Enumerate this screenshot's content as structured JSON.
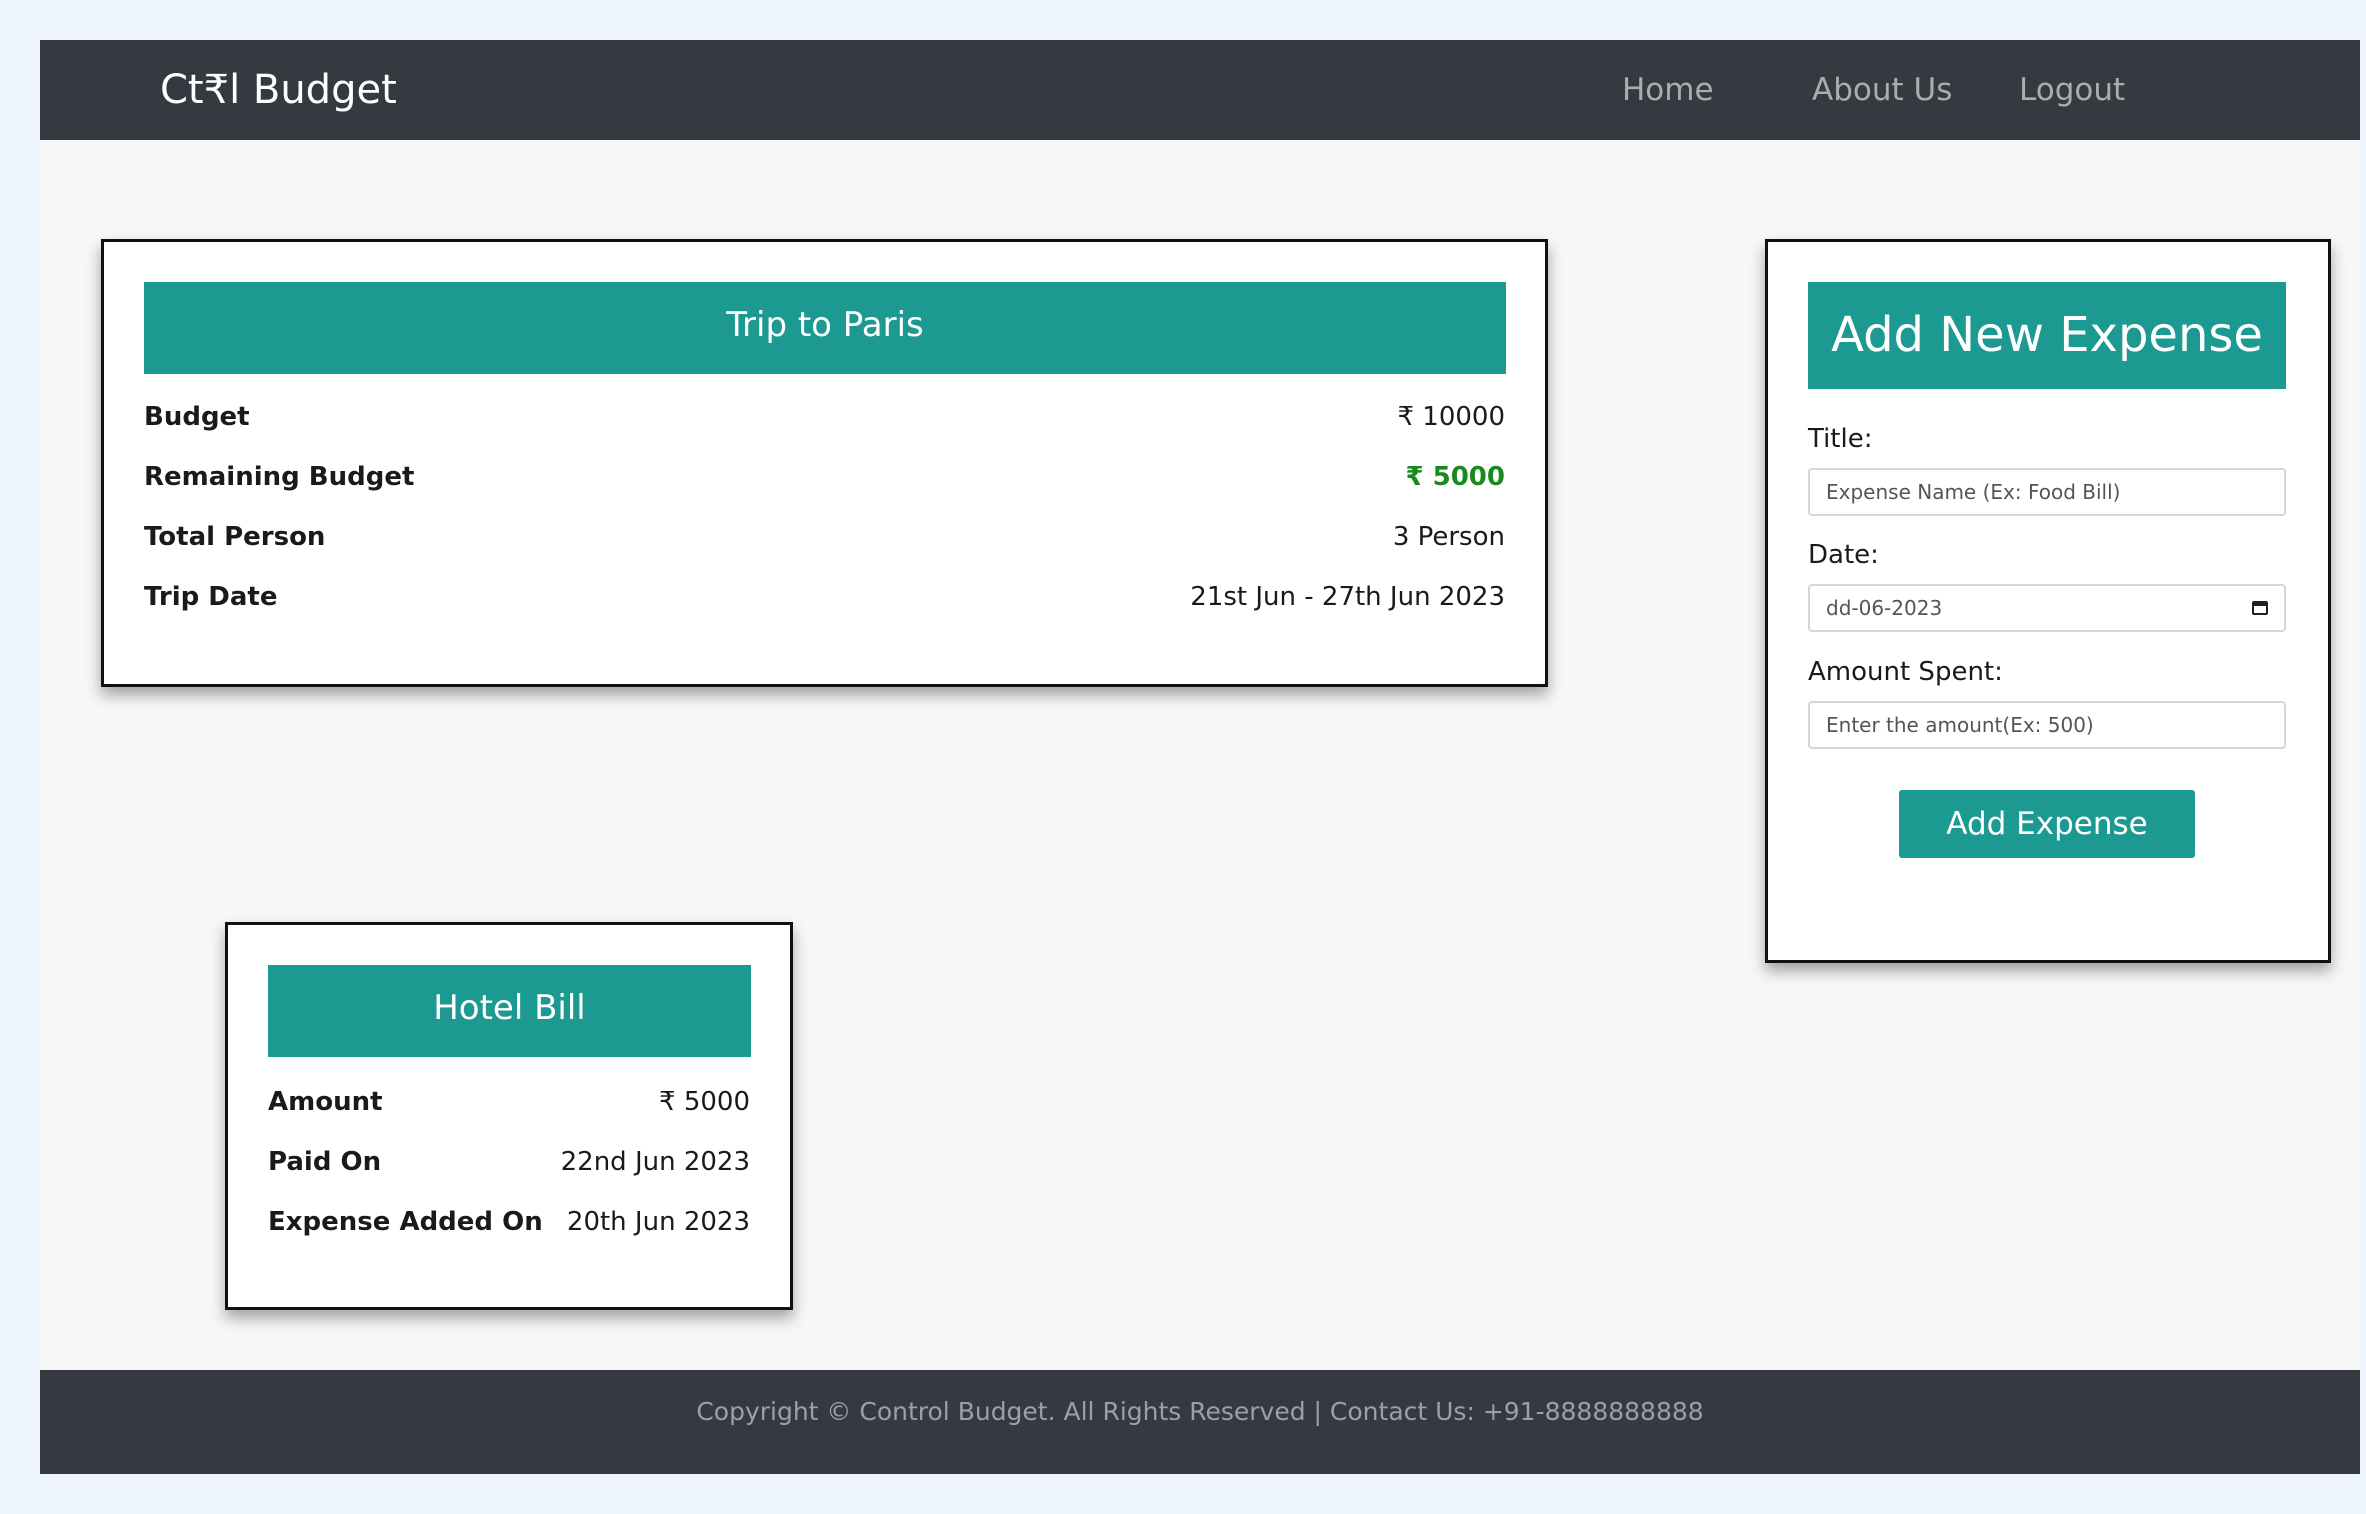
{
  "navbar": {
    "brand": "Ct₹l Budget",
    "links": [
      "Home",
      "About Us",
      "Logout"
    ]
  },
  "trip_card": {
    "title": "Trip to Paris",
    "rows": [
      {
        "label": "Budget",
        "value": "₹ 10000"
      },
      {
        "label": "Remaining Budget",
        "value": "₹ 5000"
      },
      {
        "label": "Total Person",
        "value": "3 Person"
      },
      {
        "label": "Trip Date",
        "value": "21st Jun - 27th Jun 2023"
      }
    ]
  },
  "expense_card": {
    "title": "Hotel Bill",
    "rows": [
      {
        "label": "Amount",
        "value": "₹ 5000"
      },
      {
        "label": "Paid On",
        "value": "22nd Jun 2023"
      },
      {
        "label": "Expense Added On",
        "value": "20th Jun 2023"
      }
    ]
  },
  "add_expense_form": {
    "title": "Add New Expense",
    "title_label": "Title:",
    "title_placeholder": "Expense Name (Ex: Food Bill)",
    "date_label": "Date:",
    "date_value": "dd-06-2023",
    "amount_label": "Amount Spent:",
    "amount_placeholder": "Enter the amount(Ex: 500)",
    "submit_label": "Add Expense"
  },
  "footer": {
    "text": "Copyright © Control Budget. All Rights Reserved | Contact Us: +91-8888888888"
  },
  "colors": {
    "navbar": "#343a40",
    "accent": "#1c9990",
    "positive": "#198a1c"
  }
}
